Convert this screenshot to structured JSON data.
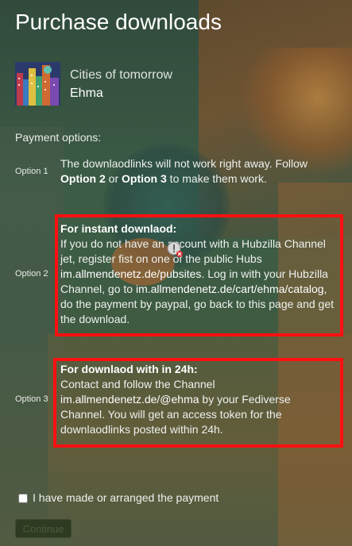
{
  "page": {
    "title": "Purchase downloads"
  },
  "album": {
    "title": "Cities of tomorrow",
    "artist": "Ehma"
  },
  "payment": {
    "label": "Payment options:",
    "option1": {
      "label": "Option 1",
      "text_a": "The downlaodlinks will not work right away. Follow ",
      "opt2": "Option 2",
      "or": " or ",
      "opt3": "Option 3",
      "text_b": " to make them work."
    },
    "option2": {
      "label": "Option 2",
      "heading": "For instant downlaod:",
      "text_a": "If you do not have an account with a Hubzilla Channel jet, register fist on one of the public Hubs ",
      "link1": "im.allmendenetz.de/pubsites",
      "text_b": ". Log in with your Hubzilla Channel, go to ",
      "link2": "im.allmendenetz.de/cart/ehma/catalog",
      "text_c": ", do the payment by paypal, go back to this page and get the download."
    },
    "option3": {
      "label": "Option 3",
      "heading": "For downlaod with in 24h:",
      "text_a": "Contact and follow the Channel ",
      "link": "im.allmendenetz.de/@ehma",
      "text_b": " by your Fediverse Channel. You will get an access token for the downlaodlinks posted within 24h."
    }
  },
  "confirm": {
    "checkbox_label": "I have made or arranged the payment",
    "checked": false,
    "continue_label": "Continue"
  },
  "colors": {
    "highlight_border": "#ff1010",
    "text": "#ffffff"
  }
}
